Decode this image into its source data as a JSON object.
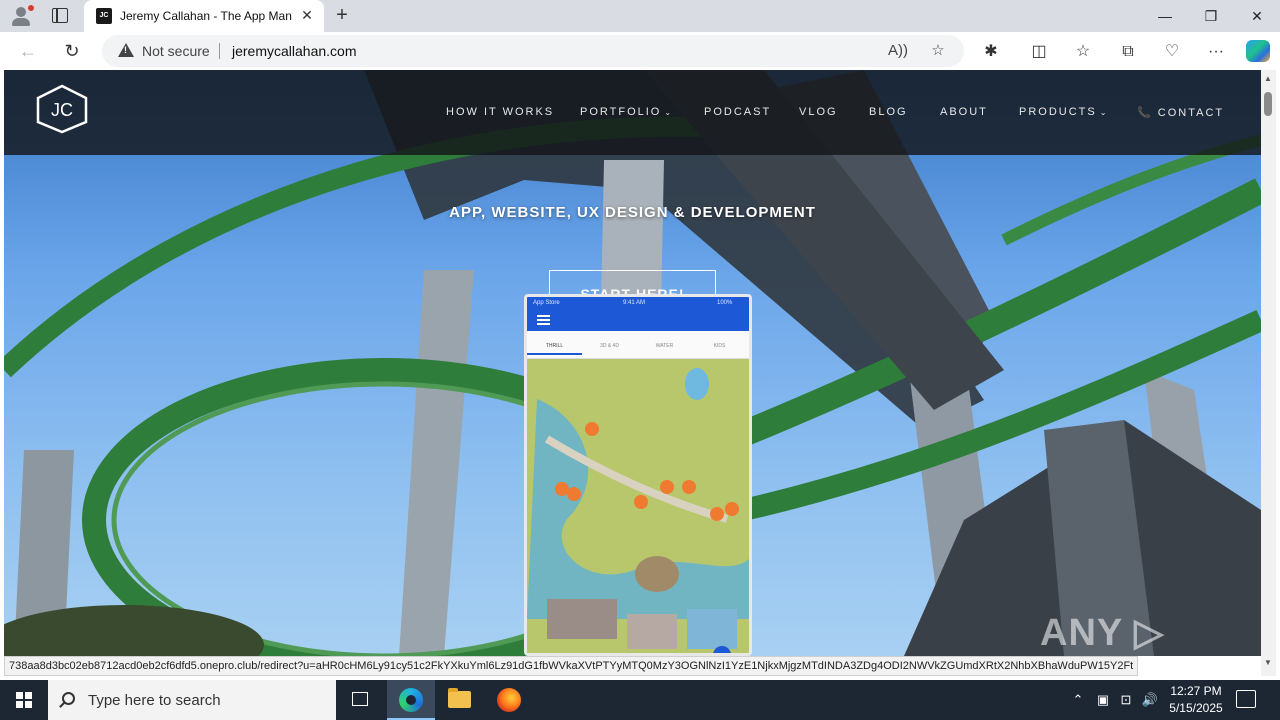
{
  "browser": {
    "tab_title": "Jeremy Callahan - The App Man",
    "tab_favicon_text": "JC",
    "new_tab_glyph": "+",
    "address": {
      "security_label": "Not secure",
      "url": "jeremycallahan.com"
    },
    "window_controls": [
      "—",
      "❐",
      "✕"
    ]
  },
  "site": {
    "logo_text": "JC",
    "nav": [
      {
        "label": "HOW IT WORKS"
      },
      {
        "label": "PORTFOLIO",
        "has_dropdown": true
      },
      {
        "label": "PODCAST"
      },
      {
        "label": "VLOG"
      },
      {
        "label": "BLOG"
      },
      {
        "label": "ABOUT"
      },
      {
        "label": "PRODUCTS",
        "has_dropdown": true
      },
      {
        "label": "CONTACT",
        "icon": "phone-icon"
      }
    ],
    "hero_title": "APP, WEBSITE, UX DESIGN & DEVELOPMENT",
    "cta_label": "START HERE!",
    "phone": {
      "status_carrier": "App Store",
      "status_time": "9:41 AM",
      "status_battery": "100%",
      "tabs": [
        "THRILL",
        "3D & 4D",
        "WATER",
        "KIDS"
      ]
    }
  },
  "status_bar_url": "738aa8d3bc02eb8712acd0eb2cf6dfd5.onepro.club/redirect?u=aHR0cHM6Ly91cy51c2FkYXkuYml6Lz91dG1fbWVkaXVtPTYyMTQ0MzY3OGNlNzI1YzE1NjkxMjgzMTdINDA3ZDg4ODI2NWVkZGUmdXRtX2NhbXBhaWduPW15Y2Ft",
  "watermark": "ANY ▷ RUN",
  "taskbar": {
    "search_placeholder": "Type here to search",
    "clock_time": "12:27 PM",
    "clock_date": "5/15/2025"
  },
  "colors": {
    "header_bg": "#14161a",
    "phone_appbar": "#1d59d6",
    "sky": "#6ba6ea",
    "coaster_green": "#2f7d3a"
  }
}
